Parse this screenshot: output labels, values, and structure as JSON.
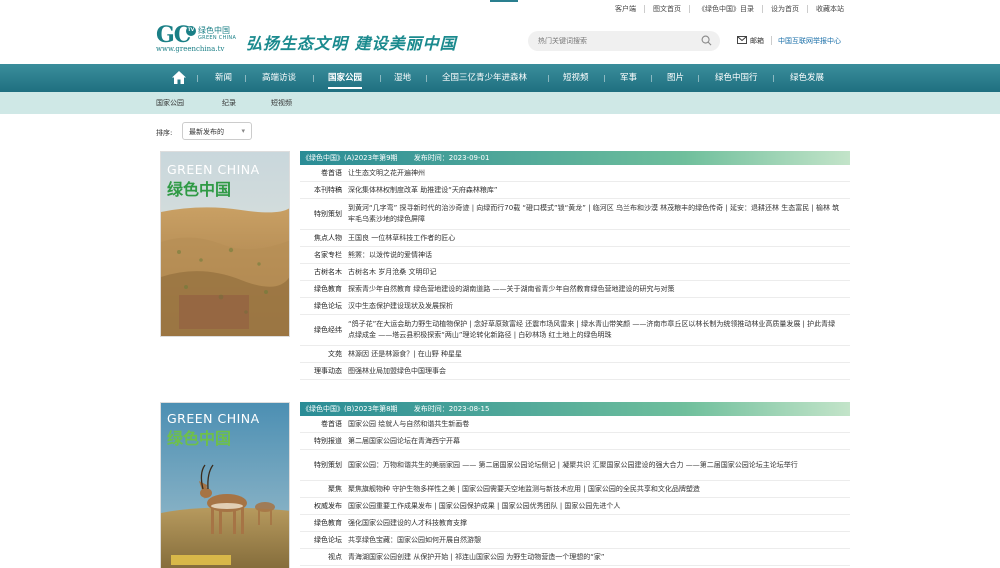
{
  "toplinks": [
    "客户端",
    "图文首页",
    "《绿色中国》目录",
    "设为首页",
    "收藏本站"
  ],
  "logo": {
    "mark": "GC",
    "tv": "TV",
    "cn": "绿色中国",
    "en": "GREEN CHINA",
    "url": "www.greenchina.tv"
  },
  "slogan": "弘扬生态文明 建设美丽中国",
  "search": {
    "placeholder": "热门关键词搜索"
  },
  "mail": "邮箱",
  "report": "中国互联网举报中心",
  "nav": [
    "新闻",
    "高端访谈",
    "国家公园",
    "湿地",
    "全国三亿青少年进森林",
    "短视频",
    "军事",
    "图片",
    "绿色中国行",
    "绿色发展"
  ],
  "subnav": [
    "国家公园",
    "纪录",
    "短视频"
  ],
  "sort": {
    "label": "排序:",
    "value": "最新发布的"
  },
  "issues": [
    {
      "title": "《绿色中国》(A)2023年第9期",
      "date": "发布时间：2023-09-01",
      "cover": {
        "en": "GREEN CHINA",
        "cn": "绿色中国"
      },
      "rows": [
        {
          "label": "卷首语",
          "text": "让生态文明之花开遍神州"
        },
        {
          "label": "本刊特稿",
          "text": "深化集体林权制度改革 助推建设“天府森林粮库”"
        },
        {
          "label": "特别策划",
          "text": "到黄河“几字弯” 探寻新时代的治沙奇迹 | 向绿而行70载 “磴口模式”锁“黄龙” | 临河区 乌兰布和沙漠 林茂粮丰的绿色传奇 | 延安：退耕还林 生态富民 | 榆林 筑牢毛乌素沙地的绿色屏障"
        },
        {
          "label": "焦点人物",
          "text": "王国良 一位林草科技工作者的匠心"
        },
        {
          "label": "名家专栏",
          "text": "熊罴：以泼传说的爱情神话"
        },
        {
          "label": "古树名木",
          "text": "古树名木 岁月沧桑 文明印记"
        },
        {
          "label": "绿色教育",
          "text": "探索青少年自然教育 绿色营地建设的湖南道路 ——关于湖南省青少年自然教育绿色营地建设的研究与对策"
        },
        {
          "label": "绿色论坛",
          "text": "汉中生态保护建设现状及发展探析"
        },
        {
          "label": "绿色经纬",
          "text": "“鸽子花”在大运会助力野生动植物保护 | 念好草原致富经 还震市场风雷来 | 绿水青山带笑颜 ——济南市章丘区以林长制为统领推动林业高质量发展 | 护此青绿 点绿成金 ——塔云县积极探索“两山”理论转化新路径 | 白砂林场 红土地上的绿色明珠"
        },
        {
          "label": "文苑",
          "text": "林源因 还是林源食？| 在山野 种星星"
        },
        {
          "label": "理事动态",
          "text": "图强林业局加盟绿色中国理事会"
        }
      ]
    },
    {
      "title": "《绿色中国》(B)2023年第8期",
      "date": "发布时间：2023-08-15",
      "cover": {
        "en": "GREEN CHINA",
        "cn": "绿色中国"
      },
      "rows": [
        {
          "label": "卷首语",
          "text": "国家公园 绘就人与自然和谐共生新画卷"
        },
        {
          "label": "特别报道",
          "text": "第二届国家公园论坛在青海西宁开幕"
        },
        {
          "label": "特别策划",
          "text": "国家公园：万物和谐共生的美丽家园 —— 第二届国家公园论坛侧记 | 凝聚共识 汇聚国家公园建设的强大合力 ——第二届国家公园论坛主论坛举行"
        },
        {
          "label": "聚焦",
          "text": "聚焦旗舰物种 守护生物多样性之美 | 国家公园需要天空地监测与新技术应用 | 国家公园的全民共享和文化品牌塑造"
        },
        {
          "label": "权威发布",
          "text": "国家公园重要工作成果发布 | 国家公园保护成果 | 国家公园优秀团队 | 国家公园先进个人"
        },
        {
          "label": "绿色教育",
          "text": "强化国家公园建设的人才科技教育支撑"
        },
        {
          "label": "绿色论坛",
          "text": "共享绿色宝藏：国家公园如何开展自然游憩"
        },
        {
          "label": "视点",
          "text": "青海湖国家公园创建 从保护开始 | 祁连山国家公园 为野生动物营造一个理想的“家”"
        }
      ]
    }
  ]
}
